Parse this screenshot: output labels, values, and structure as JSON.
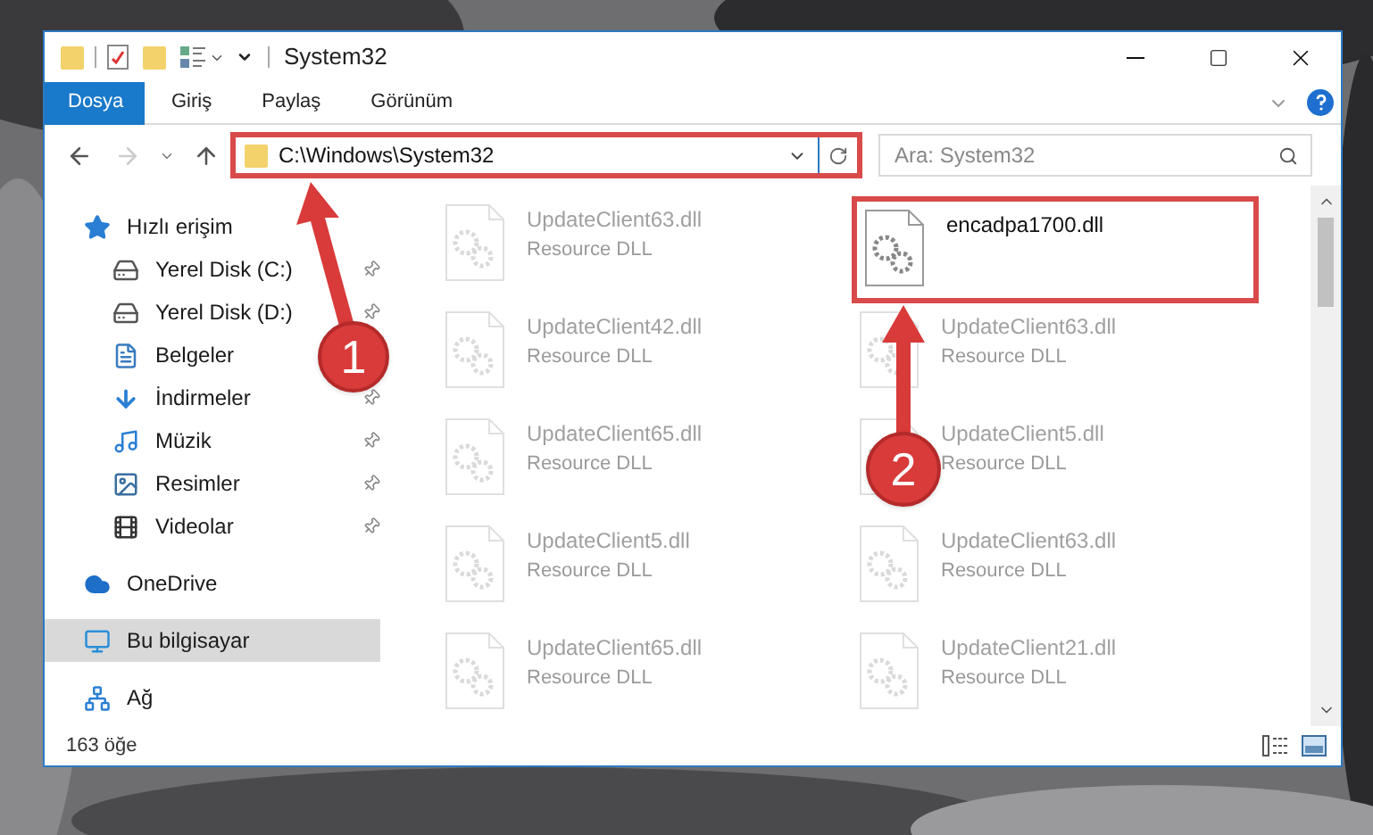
{
  "window": {
    "title": "System32"
  },
  "ribbon_tabs": [
    {
      "label": "Dosya",
      "selected": true
    },
    {
      "label": "Giriş",
      "selected": false
    },
    {
      "label": "Paylaş",
      "selected": false
    },
    {
      "label": "Görünüm",
      "selected": false
    }
  ],
  "address": {
    "value": "C:\\Windows\\System32",
    "highlighted": true
  },
  "search": {
    "placeholder": "Ara: System32"
  },
  "sidebar": {
    "items": [
      {
        "label": "Hızlı erişim",
        "kind": "star",
        "selected": false,
        "pinned": false,
        "children": [
          {
            "label": "Yerel Disk (C:)",
            "kind": "windisk",
            "selected": false,
            "pinned": true
          },
          {
            "label": "Yerel Disk (D:)",
            "kind": "disk",
            "selected": false,
            "pinned": true
          },
          {
            "label": "Belgeler",
            "kind": "docs",
            "selected": false,
            "pinned": false
          },
          {
            "label": "İndirmeler",
            "kind": "download",
            "selected": false,
            "pinned": true
          },
          {
            "label": "Müzik",
            "kind": "music",
            "selected": false,
            "pinned": true
          },
          {
            "label": "Resimler",
            "kind": "pictures",
            "selected": false,
            "pinned": true
          },
          {
            "label": "Videolar",
            "kind": "video",
            "selected": false,
            "pinned": true
          }
        ]
      },
      {
        "label": "OneDrive",
        "kind": "cloud",
        "selected": false,
        "pinned": false
      },
      {
        "label": "Bu bilgisayar",
        "kind": "pc",
        "selected": true,
        "pinned": false
      },
      {
        "label": "Ağ",
        "kind": "network",
        "selected": false,
        "pinned": false
      }
    ]
  },
  "files": [
    {
      "name": "UpdateClient63.dll",
      "type": "Resource DLL",
      "faded": true,
      "highlighted": false
    },
    {
      "name": "encadpa1700.dll",
      "faded": false,
      "highlighted": true
    },
    {
      "name": "UpdateClient42.dll",
      "type": "Resource DLL",
      "faded": true,
      "highlighted": false
    },
    {
      "name": "UpdateClient63.dll",
      "type": "Resource DLL",
      "faded": true,
      "highlighted": false
    },
    {
      "name": "UpdateClient65.dll",
      "type": "Resource DLL",
      "faded": true,
      "highlighted": false
    },
    {
      "name": "UpdateClient5.dll",
      "type": "Resource DLL",
      "faded": true,
      "highlighted": false
    },
    {
      "name": "UpdateClient5.dll",
      "type": "Resource DLL",
      "faded": true,
      "highlighted": false
    },
    {
      "name": "UpdateClient63.dll",
      "type": "Resource DLL",
      "faded": true,
      "highlighted": false
    },
    {
      "name": "UpdateClient65.dll",
      "type": "Resource DLL",
      "faded": true,
      "highlighted": false
    },
    {
      "name": "UpdateClient21.dll",
      "type": "Resource DLL",
      "faded": true,
      "highlighted": false
    }
  ],
  "status_bar": {
    "count": "163 öğe"
  },
  "annotations": [
    {
      "label": "1"
    },
    {
      "label": "2"
    }
  ]
}
